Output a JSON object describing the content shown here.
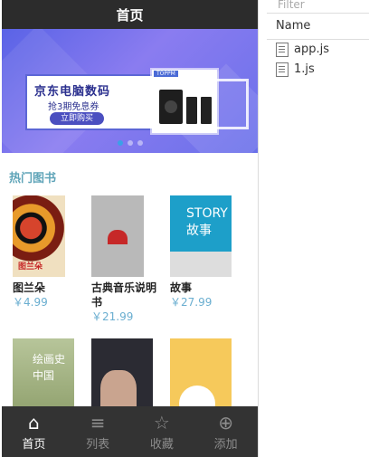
{
  "app": {
    "title": "首页"
  },
  "banner": {
    "promo_title": "京东电脑数码",
    "promo_sub": "抢3期免息券",
    "promo_button": "立即购买",
    "product_tag": "TOPPM",
    "dots_count": 3,
    "active_dot": 0
  },
  "section": {
    "title": "热门图书"
  },
  "books": [
    {
      "title": "图兰朵",
      "price": "￥4.99",
      "cover_text": "图兰朵"
    },
    {
      "title": "古典音乐说明书",
      "price": "￥21.99",
      "cover_text": ""
    },
    {
      "title": "故事",
      "price": "￥27.99",
      "cover_text": "STORY 故事"
    },
    {
      "title": "",
      "price": "",
      "cover_text": "绘画史中国"
    },
    {
      "title": "",
      "price": "",
      "cover_text": ""
    },
    {
      "title": "",
      "price": "",
      "cover_text": ""
    }
  ],
  "tabbar": {
    "items": [
      {
        "label": "首页",
        "icon": "home-icon",
        "active": true
      },
      {
        "label": "列表",
        "icon": "list-icon",
        "active": false
      },
      {
        "label": "收藏",
        "icon": "star-icon",
        "active": false
      },
      {
        "label": "添加",
        "icon": "plus-circle-icon",
        "active": false
      }
    ]
  },
  "devtools": {
    "filter_placeholder": "Filter",
    "column_header": "Name",
    "files": [
      "app.js",
      "1.js"
    ]
  }
}
